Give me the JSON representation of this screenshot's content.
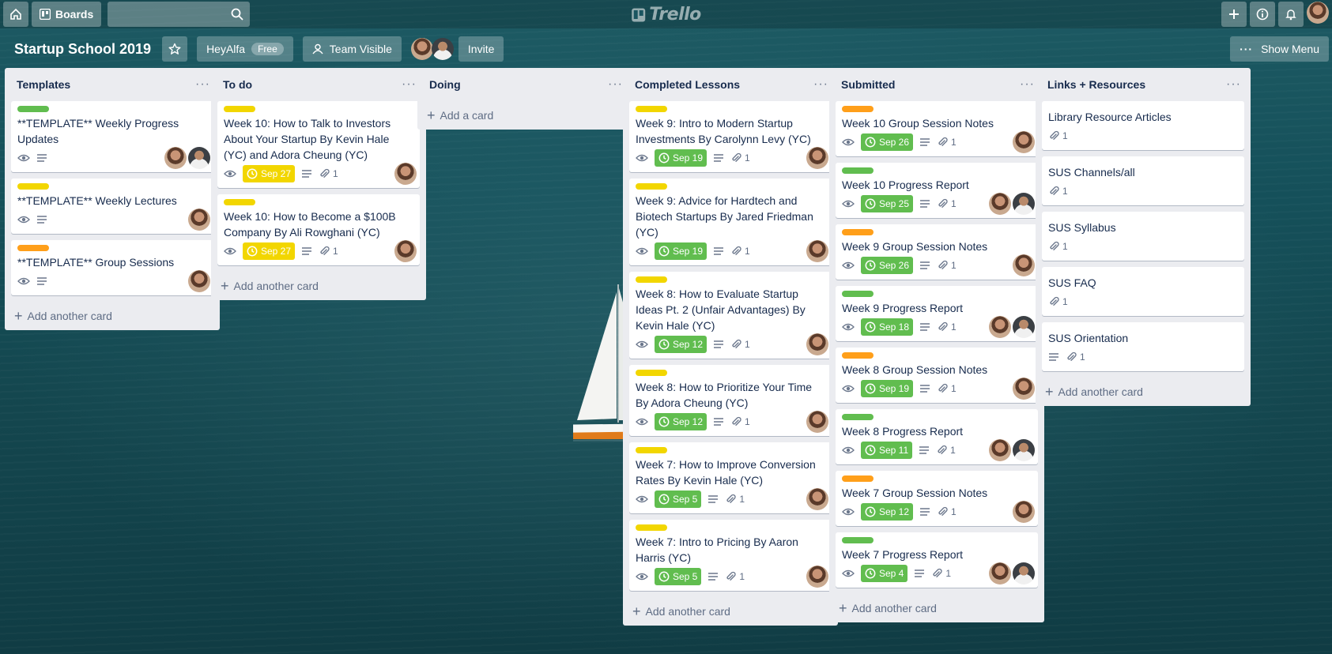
{
  "header": {
    "boards_label": "Boards",
    "search_placeholder": "",
    "logo_text": "Trello"
  },
  "board": {
    "title": "Startup School 2019",
    "team_name": "HeyAlfa",
    "team_badge": "Free",
    "visibility": "Team Visible",
    "invite_label": "Invite",
    "show_menu_label": "Show Menu"
  },
  "colors": {
    "label_green": "#61bd4f",
    "label_yellow": "#f2d600",
    "label_orange": "#ff9f1a",
    "list_bg": "#ebecf0"
  },
  "lists": [
    {
      "title": "Templates",
      "add_label": "Add another card",
      "cards": [
        {
          "label": "green",
          "title": "**TEMPLATE** Weekly Progress Updates",
          "watch": true,
          "desc": true,
          "members": [
            "a",
            "b"
          ]
        },
        {
          "label": "yellow",
          "title": "**TEMPLATE** Weekly Lectures",
          "watch": true,
          "desc": true,
          "members": [
            "a"
          ]
        },
        {
          "label": "orange",
          "title": "**TEMPLATE** Group Sessions",
          "watch": true,
          "desc": true,
          "members": [
            "a"
          ]
        }
      ]
    },
    {
      "title": "To do",
      "add_label": "Add another card",
      "cards": [
        {
          "label": "yellow",
          "title": "Week 10: How to Talk to Investors About Your Startup By Kevin Hale (YC) and Adora Cheung (YC)",
          "watch": true,
          "due": "Sep 27",
          "due_color": "yellow",
          "desc": true,
          "attachments": "1",
          "members": [
            "a"
          ]
        },
        {
          "label": "yellow",
          "title": "Week 10: How to Become a $100B Company By Ali Rowghani (YC)",
          "watch": true,
          "due": "Sep 27",
          "due_color": "yellow",
          "desc": true,
          "attachments": "1",
          "members": [
            "a"
          ]
        }
      ]
    },
    {
      "title": "Doing",
      "add_label": "Add a card",
      "cards": []
    },
    {
      "title": "Completed Lessons",
      "add_label": "Add another card",
      "cards": [
        {
          "label": "yellow",
          "title": "Week 9: Intro to Modern Startup Investments By Carolynn Levy (YC)",
          "watch": true,
          "due": "Sep 19",
          "due_color": "green",
          "desc": true,
          "attachments": "1",
          "members": [
            "a"
          ]
        },
        {
          "label": "yellow",
          "title": "Week 9: Advice for Hardtech and Biotech Startups By Jared Friedman (YC)",
          "watch": true,
          "due": "Sep 19",
          "due_color": "green",
          "desc": true,
          "attachments": "1",
          "members": [
            "a"
          ]
        },
        {
          "label": "yellow",
          "title": "Week 8: How to Evaluate Startup Ideas Pt. 2 (Unfair Advantages) By Kevin Hale (YC)",
          "watch": true,
          "due": "Sep 12",
          "due_color": "green",
          "desc": true,
          "attachments": "1",
          "members": [
            "a"
          ]
        },
        {
          "label": "yellow",
          "title": "Week 8: How to Prioritize Your Time By Adora Cheung (YC)",
          "watch": true,
          "due": "Sep 12",
          "due_color": "green",
          "desc": true,
          "attachments": "1",
          "members": [
            "a"
          ]
        },
        {
          "label": "yellow",
          "title": "Week 7: How to Improve Conversion Rates By Kevin Hale (YC)",
          "watch": true,
          "due": "Sep 5",
          "due_color": "green",
          "desc": true,
          "attachments": "1",
          "members": [
            "a"
          ]
        },
        {
          "label": "yellow",
          "title": "Week 7: Intro to Pricing By Aaron Harris (YC)",
          "watch": true,
          "due": "Sep 5",
          "due_color": "green",
          "desc": true,
          "attachments": "1",
          "members": [
            "a"
          ]
        }
      ]
    },
    {
      "title": "Submitted",
      "add_label": "Add another card",
      "cards": [
        {
          "label": "orange",
          "title": "Week 10 Group Session Notes",
          "watch": true,
          "due": "Sep 26",
          "due_color": "green",
          "desc": true,
          "attachments": "1",
          "members": [
            "a"
          ]
        },
        {
          "label": "green",
          "title": "Week 10 Progress Report",
          "watch": true,
          "due": "Sep 25",
          "due_color": "green",
          "desc": true,
          "attachments": "1",
          "members": [
            "a",
            "b"
          ]
        },
        {
          "label": "orange",
          "title": "Week 9 Group Session Notes",
          "watch": true,
          "due": "Sep 26",
          "due_color": "green",
          "desc": true,
          "attachments": "1",
          "members": [
            "a"
          ]
        },
        {
          "label": "green",
          "title": "Week 9 Progress Report",
          "watch": true,
          "due": "Sep 18",
          "due_color": "green",
          "desc": true,
          "attachments": "1",
          "members": [
            "a",
            "b"
          ]
        },
        {
          "label": "orange",
          "title": "Week 8 Group Session Notes",
          "watch": true,
          "due": "Sep 19",
          "due_color": "green",
          "desc": true,
          "attachments": "1",
          "members": [
            "a"
          ]
        },
        {
          "label": "green",
          "title": "Week 8 Progress Report",
          "watch": true,
          "due": "Sep 11",
          "due_color": "green",
          "desc": true,
          "attachments": "1",
          "members": [
            "a",
            "b"
          ]
        },
        {
          "label": "orange",
          "title": "Week 7 Group Session Notes",
          "watch": true,
          "due": "Sep 12",
          "due_color": "green",
          "desc": true,
          "attachments": "1",
          "members": [
            "a"
          ]
        },
        {
          "label": "green",
          "title": "Week 7 Progress Report",
          "watch": true,
          "due": "Sep 4",
          "due_color": "green",
          "desc": true,
          "attachments": "1",
          "members": [
            "a",
            "b"
          ]
        }
      ]
    },
    {
      "title": "Links + Resources",
      "add_label": "Add another card",
      "cards": [
        {
          "title": "Library Resource Articles",
          "attachments": "1"
        },
        {
          "title": "SUS Channels/all",
          "attachments": "1"
        },
        {
          "title": "SUS Syllabus",
          "attachments": "1"
        },
        {
          "title": "SUS FAQ",
          "attachments": "1"
        },
        {
          "title": "SUS Orientation",
          "desc": true,
          "attachments": "1"
        }
      ]
    }
  ]
}
